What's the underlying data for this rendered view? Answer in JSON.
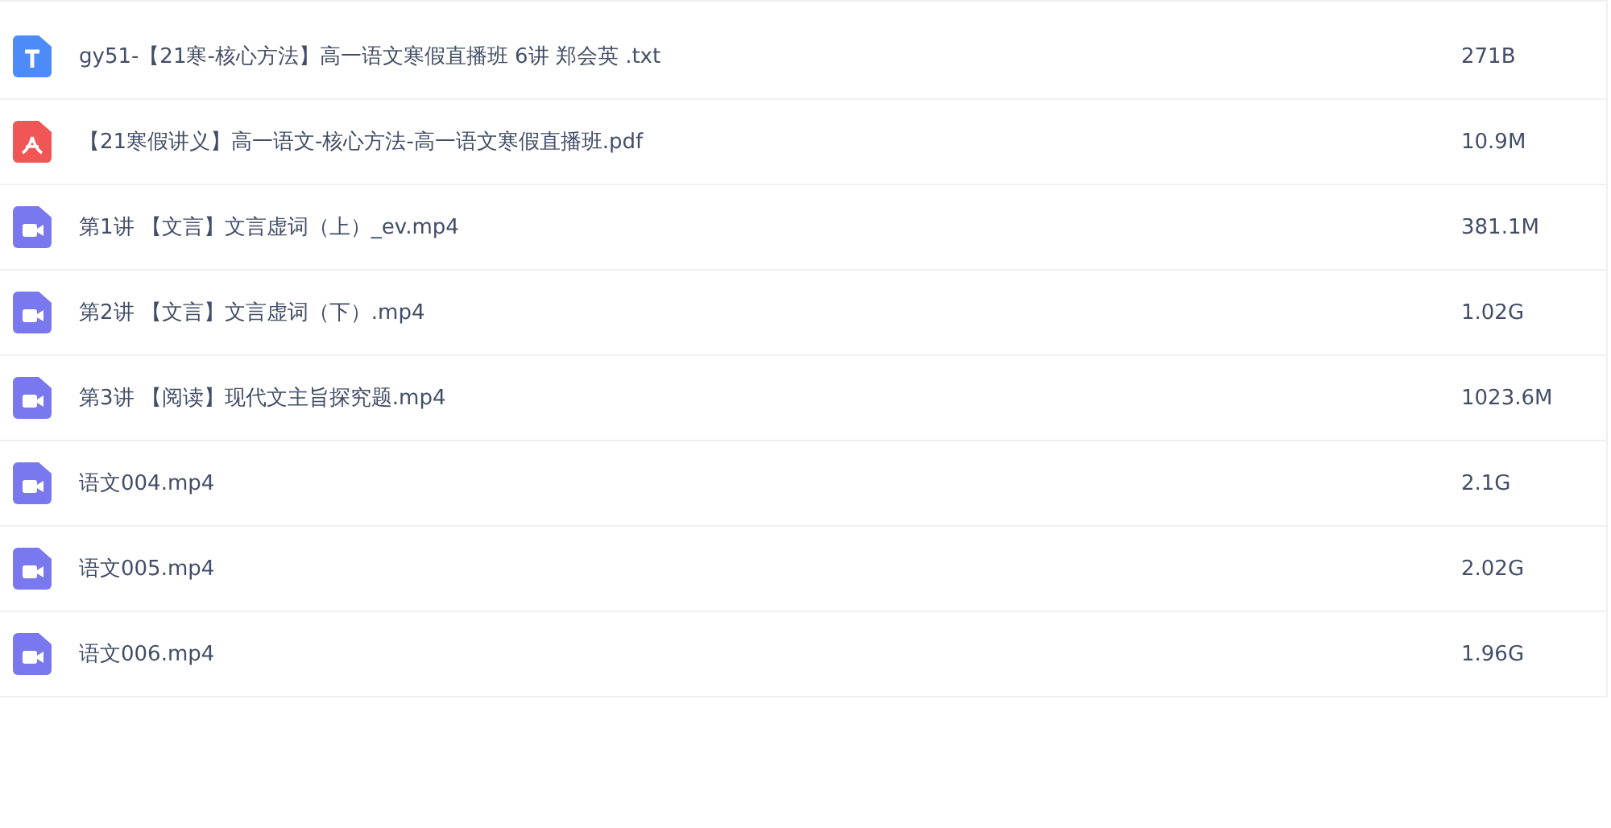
{
  "files": [
    {
      "kind": "txt",
      "name": "gy51-【21寒-核心方法】高一语文寒假直播班 6讲 郑会英 .txt",
      "size": "271B"
    },
    {
      "kind": "pdf",
      "name": "【21寒假讲义】高一语文-核心方法-高一语文寒假直播班.pdf",
      "size": "10.9M"
    },
    {
      "kind": "video",
      "name": "第1讲 【文言】文言虚词（上）_ev.mp4",
      "size": "381.1M"
    },
    {
      "kind": "video",
      "name": "第2讲 【文言】文言虚词（下）.mp4",
      "size": "1.02G"
    },
    {
      "kind": "video",
      "name": "第3讲 【阅读】现代文主旨探究题.mp4",
      "size": "1023.6M"
    },
    {
      "kind": "video",
      "name": "语文004.mp4",
      "size": "2.1G"
    },
    {
      "kind": "video",
      "name": "语文005.mp4",
      "size": "2.02G"
    },
    {
      "kind": "video",
      "name": "语文006.mp4",
      "size": "1.96G"
    }
  ]
}
